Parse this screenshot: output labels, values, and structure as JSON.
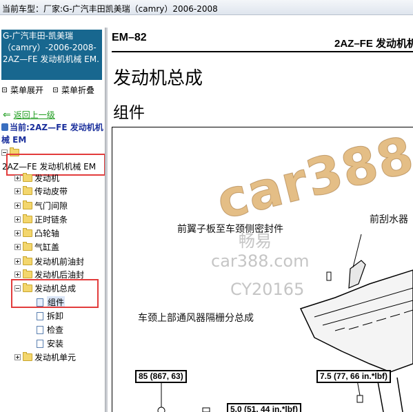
{
  "header": {
    "current_model": "当前车型：厂家:G-广汽丰田凯美瑞（camry）2006-2008"
  },
  "sidebar": {
    "title": "G-广汽丰田-凯美瑞（camry）-2006-2008- 2AZ—FE 发动机机械 EM.",
    "expand_all": "菜单展开",
    "collapse_all": "菜单折叠",
    "back_label": "返回上一级",
    "current_label": "当前:2AZ—FE 发动机机械 EM",
    "root_label": "2AZ—FE 发动机机械 EM",
    "tree": [
      {
        "label": "发动机",
        "expanded": false
      },
      {
        "label": "传动皮带",
        "expanded": false
      },
      {
        "label": "气门间隙",
        "expanded": false
      },
      {
        "label": "正时链条",
        "expanded": false
      },
      {
        "label": "凸轮轴",
        "expanded": false
      },
      {
        "label": "气缸盖",
        "expanded": false
      },
      {
        "label": "发动机前油封",
        "expanded": false
      },
      {
        "label": "发动机后油封",
        "expanded": false
      },
      {
        "label": "发动机总成",
        "expanded": true
      },
      {
        "label": "组件",
        "selected": true
      },
      {
        "label": "拆卸"
      },
      {
        "label": "检查"
      },
      {
        "label": "安装"
      },
      {
        "label": "发动机单元",
        "expanded": false
      }
    ]
  },
  "document": {
    "page_code": "EM–82",
    "header_right": "2AZ–FE  发动机机",
    "main_title": "发动机总成",
    "sub_title": "组件",
    "callouts": [
      "前翼子板至车颈侧密封件",
      "前刮水器",
      "车颈上部通风器隔栅分总成"
    ],
    "torques": [
      "85 (867, 63)",
      "7.5 (77, 66 in.*lbf)",
      "5.0 (51, 44 in.*lbf)"
    ],
    "watermarks": [
      "car388.c",
      "畅易",
      "car388.com",
      "CY20165"
    ]
  },
  "colors": {
    "title_bg": "#18678f",
    "highlight_red": "#e23b3b",
    "link_green": "#1d9c1d",
    "current_blue": "#1a2f9c"
  }
}
